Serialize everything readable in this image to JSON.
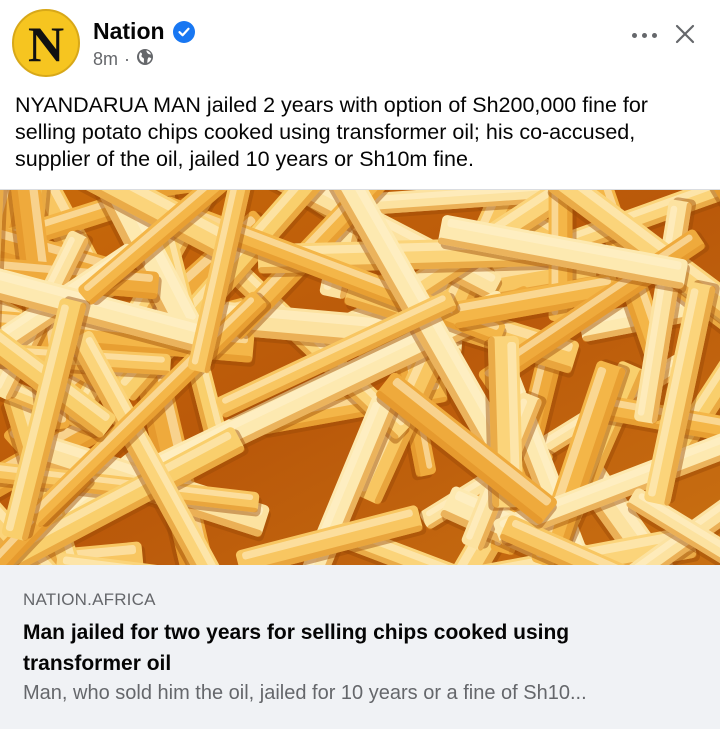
{
  "post": {
    "page_name": "Nation",
    "avatar_letter": "N",
    "time": "8m",
    "separator": "·",
    "text": "NYANDARUA MAN jailed 2 years with option of Sh200,000 fine for selling potato chips cooked using transformer oil; his co-accused, supplier of the oil, jailed 10 years or Sh10m fine."
  },
  "link_preview": {
    "domain": "NATION.AFRICA",
    "title": "Man jailed for two years for selling chips cooked using transformer oil",
    "description": "Man, who sold him the oil, jailed for 10 years or a fine of Sh10..."
  },
  "icons": {
    "verified": "verified-badge-icon",
    "audience": "globe-icon",
    "more": "more-options-icon",
    "close": "close-icon"
  },
  "colors": {
    "brand_avatar": "#f6c520",
    "verified_blue": "#1877f2",
    "muted_text": "#65676b",
    "card_background": "#f0f2f5"
  }
}
